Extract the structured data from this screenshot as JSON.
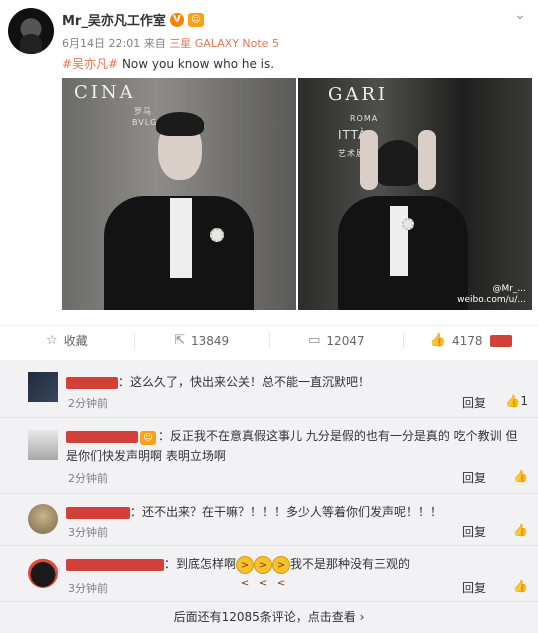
{
  "post": {
    "username": "Mr_吴亦凡工作室",
    "verified_glyph": "V",
    "vip_glyph": "☺",
    "time": "6月14日 22:01",
    "via": "来自",
    "device": "三星 GALAXY Note 5",
    "tag": "#吴亦凡#",
    "text": " Now you know who he is.",
    "photo_left_banner": "CINA",
    "photo_left_sub": "罗马",
    "photo_left_sub2": "BVLGARI",
    "photo_right_banner": "GARI",
    "photo_right_sub": "艺术展",
    "photo_right_sub2": "ROMA",
    "photo_right_sub3": "ITTÀ",
    "watermark_handle": "@Mr_...",
    "watermark_url": "weibo.com/u/..."
  },
  "actions": {
    "favorite_label": "收藏",
    "repost_count": "13849",
    "comment_count": "12047",
    "like_count": "4178"
  },
  "comments": [
    {
      "text": "：这么久了，快出来公关！总不能一直沉默吧！",
      "time": "2分钟前",
      "reply": "回复",
      "likes": "1"
    },
    {
      "text": "：反正我不在意真假这事儿 九分是假的也有一分是真的 吃个教训 但是你们快发声明啊 表明立场啊",
      "time": "2分钟前",
      "reply": "回复",
      "likes": ""
    },
    {
      "text": "：还不出来？在干嘛？！！！多少人等着你们发声呢！！！",
      "time": "3分钟前",
      "reply": "回复",
      "likes": ""
    },
    {
      "text_before": "：到底怎样啊",
      "text_after": "我不是那种没有三观的",
      "time": "3分钟前",
      "reply": "回复",
      "likes": ""
    }
  ],
  "more_comments": "后面还有12085条评论，点击查看 ›",
  "colors": {
    "accent": "#eb7350",
    "redact": "#d3403a"
  }
}
